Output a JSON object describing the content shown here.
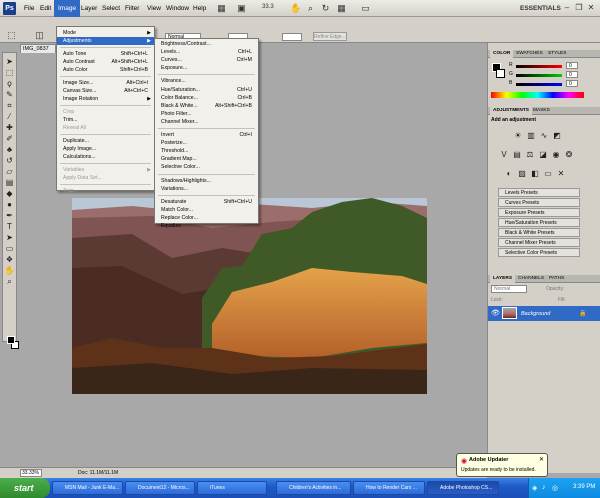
{
  "menubar": {
    "items": [
      "File",
      "Edit",
      "Image",
      "Layer",
      "Select",
      "Filter",
      "View",
      "Window",
      "Help"
    ],
    "zoom": "33.3",
    "workspace": "ESSENTIALS"
  },
  "optbar": {
    "mode_value": "Normal",
    "refine_label": "Refine Edge..."
  },
  "doc_tab": "IMG_0837",
  "image_menu": {
    "items": [
      {
        "label": "Mode",
        "sub": true
      },
      {
        "label": "Adjustments",
        "sub": true,
        "highlight": true
      },
      {
        "label": "Auto Tone",
        "shortcut": "Shift+Ctrl+L"
      },
      {
        "label": "Auto Contrast",
        "shortcut": "Alt+Shift+Ctrl+L"
      },
      {
        "label": "Auto Color",
        "shortcut": "Shift+Ctrl+B"
      },
      {
        "label": "Image Size...",
        "shortcut": "Alt+Ctrl+I"
      },
      {
        "label": "Canvas Size...",
        "shortcut": "Alt+Ctrl+C"
      },
      {
        "label": "Image Rotation",
        "sub": true
      },
      {
        "label": "Crop",
        "disabled": true
      },
      {
        "label": "Trim..."
      },
      {
        "label": "Reveal All",
        "disabled": true
      },
      {
        "label": "Duplicate..."
      },
      {
        "label": "Apply Image..."
      },
      {
        "label": "Calculations..."
      },
      {
        "label": "Variables",
        "sub": true,
        "disabled": true
      },
      {
        "label": "Apply Data Set...",
        "disabled": true
      },
      {
        "label": "Trap...",
        "disabled": true
      }
    ]
  },
  "adjust_menu": {
    "items": [
      {
        "label": "Brightness/Contrast..."
      },
      {
        "label": "Levels...",
        "shortcut": "Ctrl+L"
      },
      {
        "label": "Curves...",
        "shortcut": "Ctrl+M"
      },
      {
        "label": "Exposure..."
      },
      {
        "label": "Vibrance..."
      },
      {
        "label": "Hue/Saturation...",
        "shortcut": "Ctrl+U"
      },
      {
        "label": "Color Balance...",
        "shortcut": "Ctrl+B"
      },
      {
        "label": "Black & White...",
        "shortcut": "Alt+Shift+Ctrl+B"
      },
      {
        "label": "Photo Filter..."
      },
      {
        "label": "Channel Mixer..."
      },
      {
        "label": "Invert",
        "shortcut": "Ctrl+I"
      },
      {
        "label": "Posterize..."
      },
      {
        "label": "Threshold..."
      },
      {
        "label": "Gradient Map..."
      },
      {
        "label": "Selective Color..."
      },
      {
        "label": "Shadows/Highlights..."
      },
      {
        "label": "Variations..."
      },
      {
        "label": "Desaturate",
        "shortcut": "Shift+Ctrl+U"
      },
      {
        "label": "Match Color..."
      },
      {
        "label": "Replace Color..."
      },
      {
        "label": "Equalize"
      }
    ]
  },
  "panels": {
    "color_tabs": [
      "COLOR",
      "SWATCHES",
      "STYLES"
    ],
    "color_channels": [
      "R",
      "G",
      "B"
    ],
    "color_values": [
      "0",
      "0",
      "0"
    ],
    "adj_tabs": [
      "ADJUSTMENTS",
      "MASKS"
    ],
    "add_adjustment": "Add an adjustment",
    "presets": [
      "Levels Presets",
      "Curves Presets",
      "Exposure Presets",
      "Hue/Saturation Presets",
      "Black & White Presets",
      "Channel Mixer Presets",
      "Selective Color Presets"
    ],
    "layer_tabs": [
      "LAYERS",
      "CHANNELS",
      "PATHS"
    ],
    "blend_mode": "Normal",
    "opacity_label": "Opacity:",
    "lock_label": "Lock:",
    "fill_label": "Fill:",
    "layer_name": "Background"
  },
  "status": {
    "zoom": "33.33%",
    "doc": "Doc: 11.1M/11.1M"
  },
  "taskbar": {
    "start": "start",
    "buttons": [
      "MSN Mail - Junk E-Ma...",
      "Document12 - Micros...",
      "iTunes",
      "Children's Activities in...",
      "How to Render Cars ...",
      "Adobe Photoshop CS..."
    ],
    "clock": "3:39 PM"
  },
  "balloon": {
    "title": "Adobe Updater",
    "text": "Updates are ready to be installed."
  }
}
